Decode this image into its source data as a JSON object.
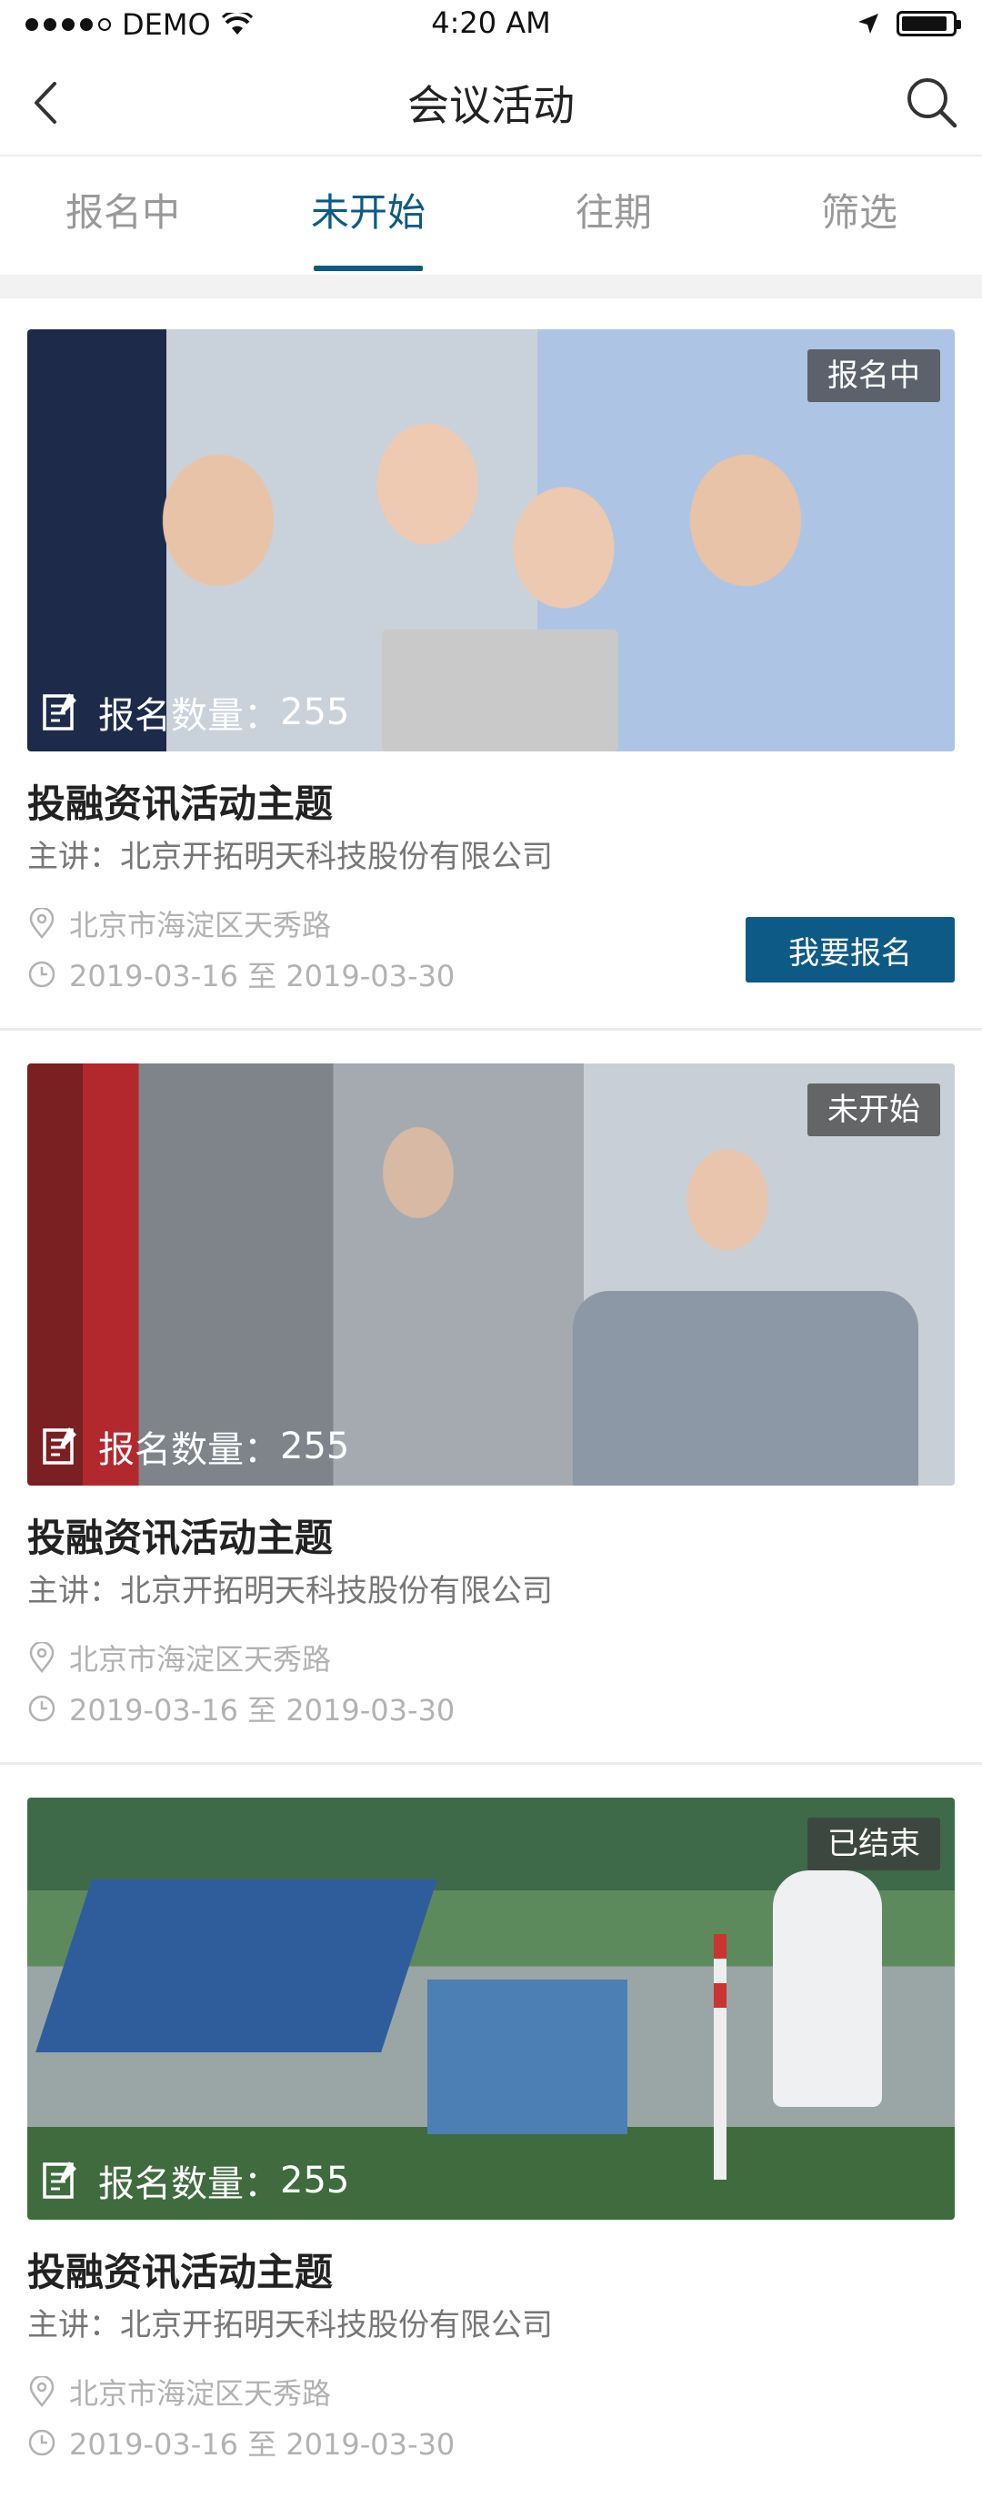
{
  "status_bar": {
    "carrier": "DEMO",
    "time": "4:20 AM",
    "battery_level": 0.9
  },
  "nav": {
    "title": "会议活动",
    "back_icon": "chevron-left-icon",
    "search_icon": "search-icon"
  },
  "tabs": [
    {
      "label": "报名中",
      "active": false
    },
    {
      "label": "未开始",
      "active": true
    },
    {
      "label": "往期",
      "active": false
    },
    {
      "label": "筛选",
      "active": false
    }
  ],
  "colors": {
    "accent": "#0d5a86",
    "muted": "#b2b2b2",
    "speaker": "#777777"
  },
  "events": [
    {
      "status": "报名中",
      "signup_label": "报名数量：",
      "signup_count": "255",
      "title": "投融资讯活动主题",
      "speaker": "主讲：北京开拓明天科技股份有限公司",
      "location": "北京市海淀区天秀路",
      "date": "2019-03-16 至 2019-03-30",
      "button_label": "我要报名"
    },
    {
      "status": "未开始",
      "signup_label": "报名数量：",
      "signup_count": "255",
      "title": "投融资讯活动主题",
      "speaker": "主讲：北京开拓明天科技股份有限公司",
      "location": "北京市海淀区天秀路",
      "date": "2019-03-16 至 2019-03-30"
    },
    {
      "status": "已结束",
      "signup_label": "报名数量：",
      "signup_count": "255",
      "title": "投融资讯活动主题",
      "speaker": "主讲：北京开拓明天科技股份有限公司",
      "location": "北京市海淀区天秀路",
      "date": "2019-03-16 至 2019-03-30"
    }
  ]
}
